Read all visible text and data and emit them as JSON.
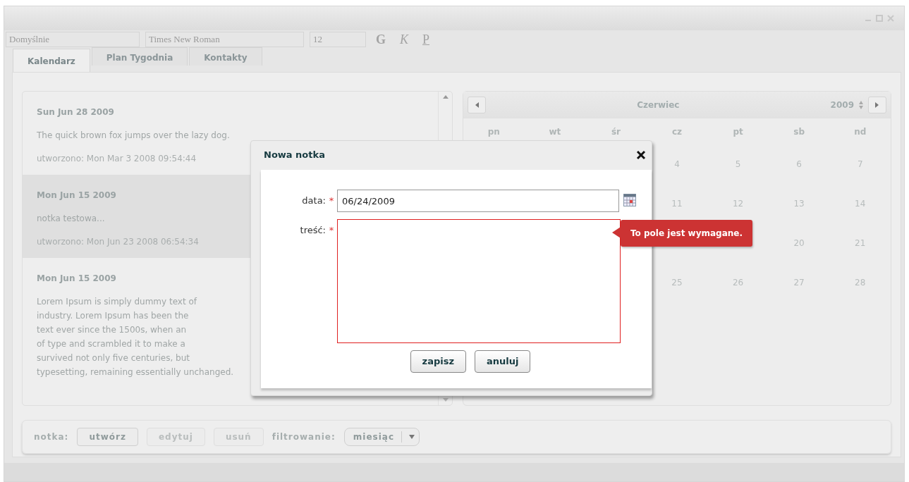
{
  "toolbar": {
    "style_select": "Domyślnie",
    "font_select": "Times New Roman",
    "size_select": "12",
    "format_buttons": [
      "G",
      "K",
      "P"
    ]
  },
  "tabs": [
    {
      "label": "Kalendarz",
      "selected": true
    },
    {
      "label": "Plan Tygodnia",
      "selected": false
    },
    {
      "label": "Kontakty",
      "selected": false
    }
  ],
  "notes": [
    {
      "date": "Sun Jun 28 2009",
      "lines": [
        "The quick brown fox jumps over the lazy dog."
      ],
      "created": "utworzono: Mon Mar 3 2008 09:54:44",
      "selected": false
    },
    {
      "date": "Mon Jun 15 2009",
      "lines": [
        "notka testowa..."
      ],
      "created": "utworzono: Mon Jun 23 2008 06:54:34",
      "selected": true
    },
    {
      "date": "Mon Jun 15 2009",
      "lines": [
        "Lorem Ipsum is simply dummy text of",
        "industry. Lorem Ipsum has been the",
        "text ever since the 1500s, when an",
        "of type and scrambled it to make a",
        "survived not only five centuries, but",
        "typesetting, remaining essentially unchanged."
      ],
      "selected": false
    }
  ],
  "calendar": {
    "month": "Czerwiec",
    "year": "2009",
    "weekdays": [
      "pn",
      "wt",
      "śr",
      "cz",
      "pt",
      "sb",
      "nd"
    ],
    "weeks": [
      [
        "4",
        "5",
        "6",
        "7"
      ],
      [
        "11",
        "12",
        "13",
        "14"
      ],
      [
        "20",
        "21"
      ],
      [
        "25",
        "26",
        "27",
        "28"
      ]
    ]
  },
  "footer": {
    "label": "notka:",
    "buttons": [
      {
        "label": "utwórz",
        "disabled": false
      },
      {
        "label": "edytuj",
        "disabled": true
      },
      {
        "label": "usuń",
        "disabled": true
      }
    ],
    "filter_label": "filtrowanie:",
    "filter_value": "miesiąc"
  },
  "dialog": {
    "title": "Nowa notka",
    "fields": [
      {
        "kind": "date",
        "label": "data:",
        "required_mark": "*",
        "value": "06/24/2009",
        "invalid": false
      },
      {
        "kind": "textarea",
        "label": "treść:",
        "required_mark": "*",
        "invalid": true
      }
    ],
    "buttons": [
      "zapisz",
      "anuluj"
    ],
    "error_tooltip": "To pole jest wymagane."
  }
}
